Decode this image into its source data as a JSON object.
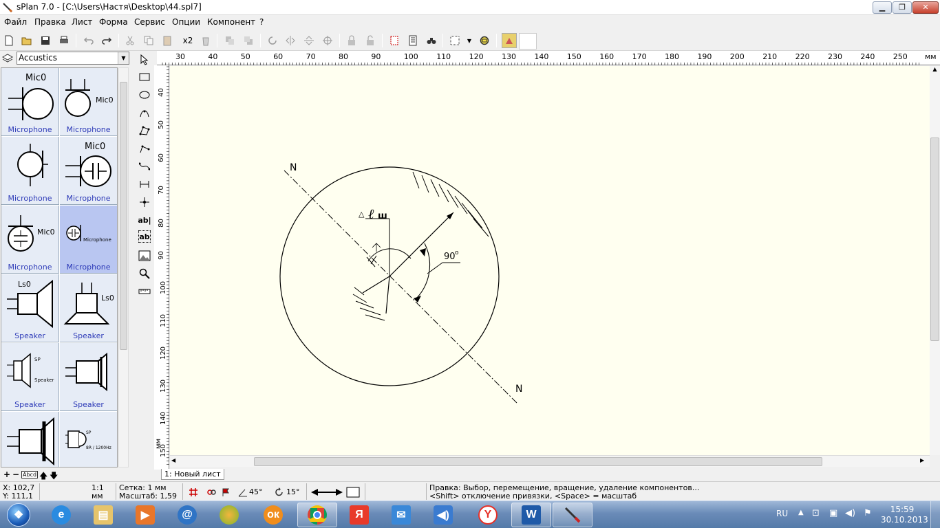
{
  "window": {
    "title": "sPlan 7.0 - [C:\\Users\\Настя\\Desktop\\44.spl7]",
    "minimize_label": "▁",
    "restore_label": "❐",
    "close_label": "✕"
  },
  "menu": [
    "Файл",
    "Правка",
    "Лист",
    "Форма",
    "Сервис",
    "Опции",
    "Компонент",
    "?"
  ],
  "toolbar": {
    "multiply_label": "x2",
    "icons": [
      "new-icon",
      "open-icon",
      "save-icon",
      "print-icon",
      "undo-icon",
      "redo-icon",
      "cut-icon",
      "copy-icon",
      "paste-icon",
      "duplicate-icon",
      "delete-icon",
      "to-front-icon",
      "to-back-icon",
      "rotate-icon",
      "mirror-h-icon",
      "mirror-v-icon",
      "align-icon",
      "lock-icon",
      "unlock-icon",
      "page-setup-icon",
      "properties-icon",
      "find-icon",
      "grid-icon",
      "zoom-icon",
      "color-icon"
    ]
  },
  "library": {
    "selected": "Accustics",
    "items": [
      {
        "label": "Microphone",
        "name": "Mic0"
      },
      {
        "label": "Microphone",
        "name": "Mic0"
      },
      {
        "label": "Microphone",
        "name": ""
      },
      {
        "label": "Microphone",
        "name": "Mic0"
      },
      {
        "label": "Microphone",
        "name": "Mic0"
      },
      {
        "label": "Microphone",
        "name": "Microphone"
      },
      {
        "label": "Speaker",
        "name": "Ls0"
      },
      {
        "label": "Speaker",
        "name": "Ls0"
      },
      {
        "label": "Speaker",
        "name": "SP"
      },
      {
        "label": "Speaker",
        "name": ""
      },
      {
        "label": "",
        "name": ""
      },
      {
        "label": "",
        "name": "SP"
      }
    ],
    "extra_texts": {
      "speaker_sub": "Speaker",
      "buzzer_sub": "8R / 1200Hz"
    },
    "footer_icons": [
      "add-icon",
      "remove-icon",
      "rename-icon",
      "move-up-icon",
      "move-down-icon"
    ],
    "footer_rename_label": "Abcd"
  },
  "tools": {
    "text_label": "ab|",
    "text_box_label": "ab",
    "icons": [
      "pointer-icon",
      "rectangle-icon",
      "ellipse-icon",
      "bezier-icon",
      "polygon-icon",
      "polyline-icon",
      "curve-icon",
      "dimension-icon",
      "node-icon",
      "text-icon",
      "textbox-icon",
      "image-icon",
      "zoom-tool-icon",
      "ruler-icon"
    ]
  },
  "rulers": {
    "h_labels": [
      "30",
      "40",
      "50",
      "60",
      "70",
      "80",
      "90",
      "100",
      "110",
      "120",
      "130",
      "140",
      "150",
      "160",
      "170",
      "180",
      "190",
      "200",
      "210",
      "220",
      "230",
      "240",
      "250"
    ],
    "h_unit": "мм",
    "v_labels": [
      "40",
      "50",
      "60",
      "70",
      "80",
      "90",
      "100",
      "110",
      "120",
      "130",
      "140",
      "150"
    ],
    "v_unit": "мм"
  },
  "drawing": {
    "label_top": "N",
    "label_bottom": "N",
    "angle_label": "90",
    "degree": "o",
    "delta_symbol": "△",
    "l_symbol": "ℓ",
    "sub_label": "ш"
  },
  "sheet_tab": "1: Новый лист",
  "status": {
    "x": "X: 102,7",
    "y": "Y: 111,1",
    "scale_top": "1:1",
    "scale_bottom": "мм",
    "grid": "Сетка: 1 мм",
    "zoom": "Масштаб:  1,59",
    "angle1": "45°",
    "angle2": "15°",
    "hint1": "Правка: Выбор, перемещение, вращение, удаление компонентов...",
    "hint2": "<Shift> отключение привязки, <Space> = масштаб"
  },
  "taskbar": {
    "lang": "RU",
    "time": "15:59",
    "date": "30.10.2013",
    "apps": [
      "start-orb",
      "ie-icon",
      "explorer-icon",
      "media-icon",
      "mail-agent-icon",
      "melon-icon",
      "odnoklassniki-icon",
      "chrome-icon",
      "yandex-icon",
      "mail-icon",
      "volume-app-icon",
      "yandex-browser-icon",
      "word-icon",
      "splan-icon"
    ]
  }
}
